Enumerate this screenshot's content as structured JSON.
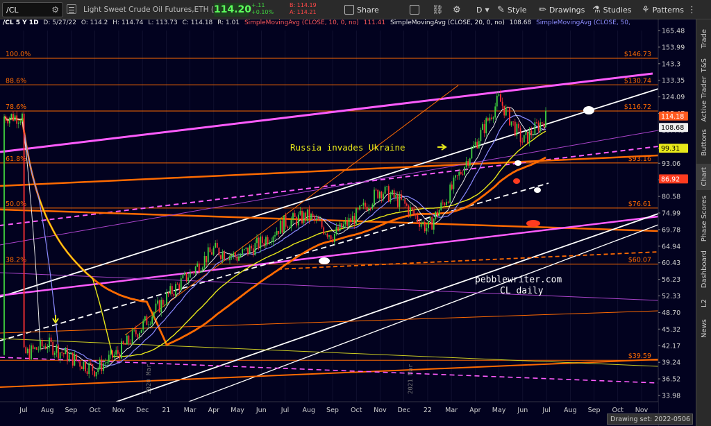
{
  "toolbar": {
    "symbol": "/CL",
    "description": "Light Sweet Crude Oil Futures,ETH (JUL 22)",
    "last_price": "114.20",
    "net_change": "+.11",
    "pct_change": "+0.10%",
    "bid": "B: 114.19",
    "ask": "A: 114.21",
    "share_label": "Share",
    "style_label": "Style",
    "drawings_label": "Drawings",
    "studies_label": "Studies",
    "patterns_label": "Patterns",
    "drawing_tool_letter": "D"
  },
  "study_bar": {
    "symbol_period": "/CL 5 Y 1D",
    "date": "D: 5/27/22",
    "open": "O: 114.2",
    "high": "H: 114.74",
    "low": "L: 113.73",
    "close": "C: 114.18",
    "range": "R: 1.01",
    "sma10_label": "SimpleMovingAvg (CLOSE, 10, 0, no)",
    "sma10_value": "111.41",
    "sma20_label": "SimpleMovingAvg (CLOSE, 20, 0, no)",
    "sma20_value": "108.68",
    "sma50_label": "SimpleMovingAvg (CLOSE, 50,"
  },
  "colors": {
    "background": "#02021f",
    "sma10": "#ff3b1f",
    "sma20": "#e6e6e6",
    "sma50": "#8a8aff",
    "sma200": "#e8e81a",
    "fib": "#ff6a00",
    "magenta": "#ff5cff",
    "price_up": "#3fd33f",
    "price_down": "#ff3030"
  },
  "price_axis": {
    "ticks": [
      "165.48",
      "153.99",
      "143.3",
      "133.35",
      "124.09",
      "115.47",
      "107.45",
      "99.31",
      "93.06",
      "86.60",
      "80.58",
      "74.99",
      "69.78",
      "64.94",
      "60.43",
      "56.23",
      "52.33",
      "48.70",
      "45.32",
      "42.17",
      "39.24",
      "36.52",
      "33.98"
    ],
    "badges": [
      {
        "label": "114.18",
        "color": "#ff5a1f",
        "text_color": "#ffffff"
      },
      {
        "label": "108.68",
        "color": "#eeeeee",
        "text_color": "#000000"
      },
      {
        "label": "99.31",
        "color": "#e8e81a",
        "text_color": "#000000"
      },
      {
        "label": "86.92",
        "color": "#ff3b1f",
        "text_color": "#ffffff"
      }
    ]
  },
  "date_axis": {
    "labels": [
      "Jul",
      "Aug",
      "Sep",
      "Oct",
      "Nov",
      "Dec",
      "21",
      "Mar",
      "Apr",
      "May",
      "Jun",
      "Jul",
      "Aug",
      "Sep",
      "Oct",
      "Nov",
      "Dec",
      "22",
      "Mar",
      "Apr",
      "May",
      "Jun",
      "Jul",
      "Aug",
      "Sep",
      "Oct",
      "Nov"
    ],
    "year_markers": [
      "2020 Mar",
      "2021 Mar"
    ]
  },
  "fib_levels": [
    {
      "pct": "100.0%",
      "price": "$146.73"
    },
    {
      "pct": "88.6%",
      "price": "$130.74"
    },
    {
      "pct": "78.6%",
      "price": "$116.72"
    },
    {
      "pct": "61.8%",
      "price": "$93.16"
    },
    {
      "pct": "50.0%",
      "price": "$76.61"
    },
    {
      "pct": "38.2%",
      "price": "$60.07"
    },
    {
      "pct": "",
      "price": "$39.59"
    }
  ],
  "annotations": {
    "event": "Russia invades Ukraine",
    "watermark_line1": "pebblewriter.com",
    "watermark_line2": "CL daily"
  },
  "side_tabs": [
    "Trade",
    "T&S",
    "Active Trader",
    "Buttons",
    "Chart",
    "Phase Scores",
    "Dashboard",
    "L2",
    "News"
  ],
  "drawing_set": "Drawing set: 2022-0506",
  "chart_data": {
    "type": "line",
    "title": "",
    "xlabel": "",
    "ylabel": "",
    "y_scale": "log",
    "ylim": [
      33.98,
      165.48
    ],
    "x": [
      "2020-07",
      "2020-08",
      "2020-09",
      "2020-10",
      "2020-11",
      "2020-12",
      "2021-01",
      "2021-03",
      "2021-04",
      "2021-05",
      "2021-06",
      "2021-07",
      "2021-08",
      "2021-09",
      "2021-10",
      "2021-11",
      "2021-12",
      "2022-01",
      "2022-03",
      "2022-04",
      "2022-05"
    ],
    "series": [
      {
        "values": [
          40.5,
          42.5,
          40,
          38,
          41,
          46,
          52,
          64,
          62,
          66,
          72,
          74,
          68,
          74,
          83,
          78,
          70,
          83,
          123,
          102,
          114
        ]
      }
    ],
    "grid": false
  }
}
